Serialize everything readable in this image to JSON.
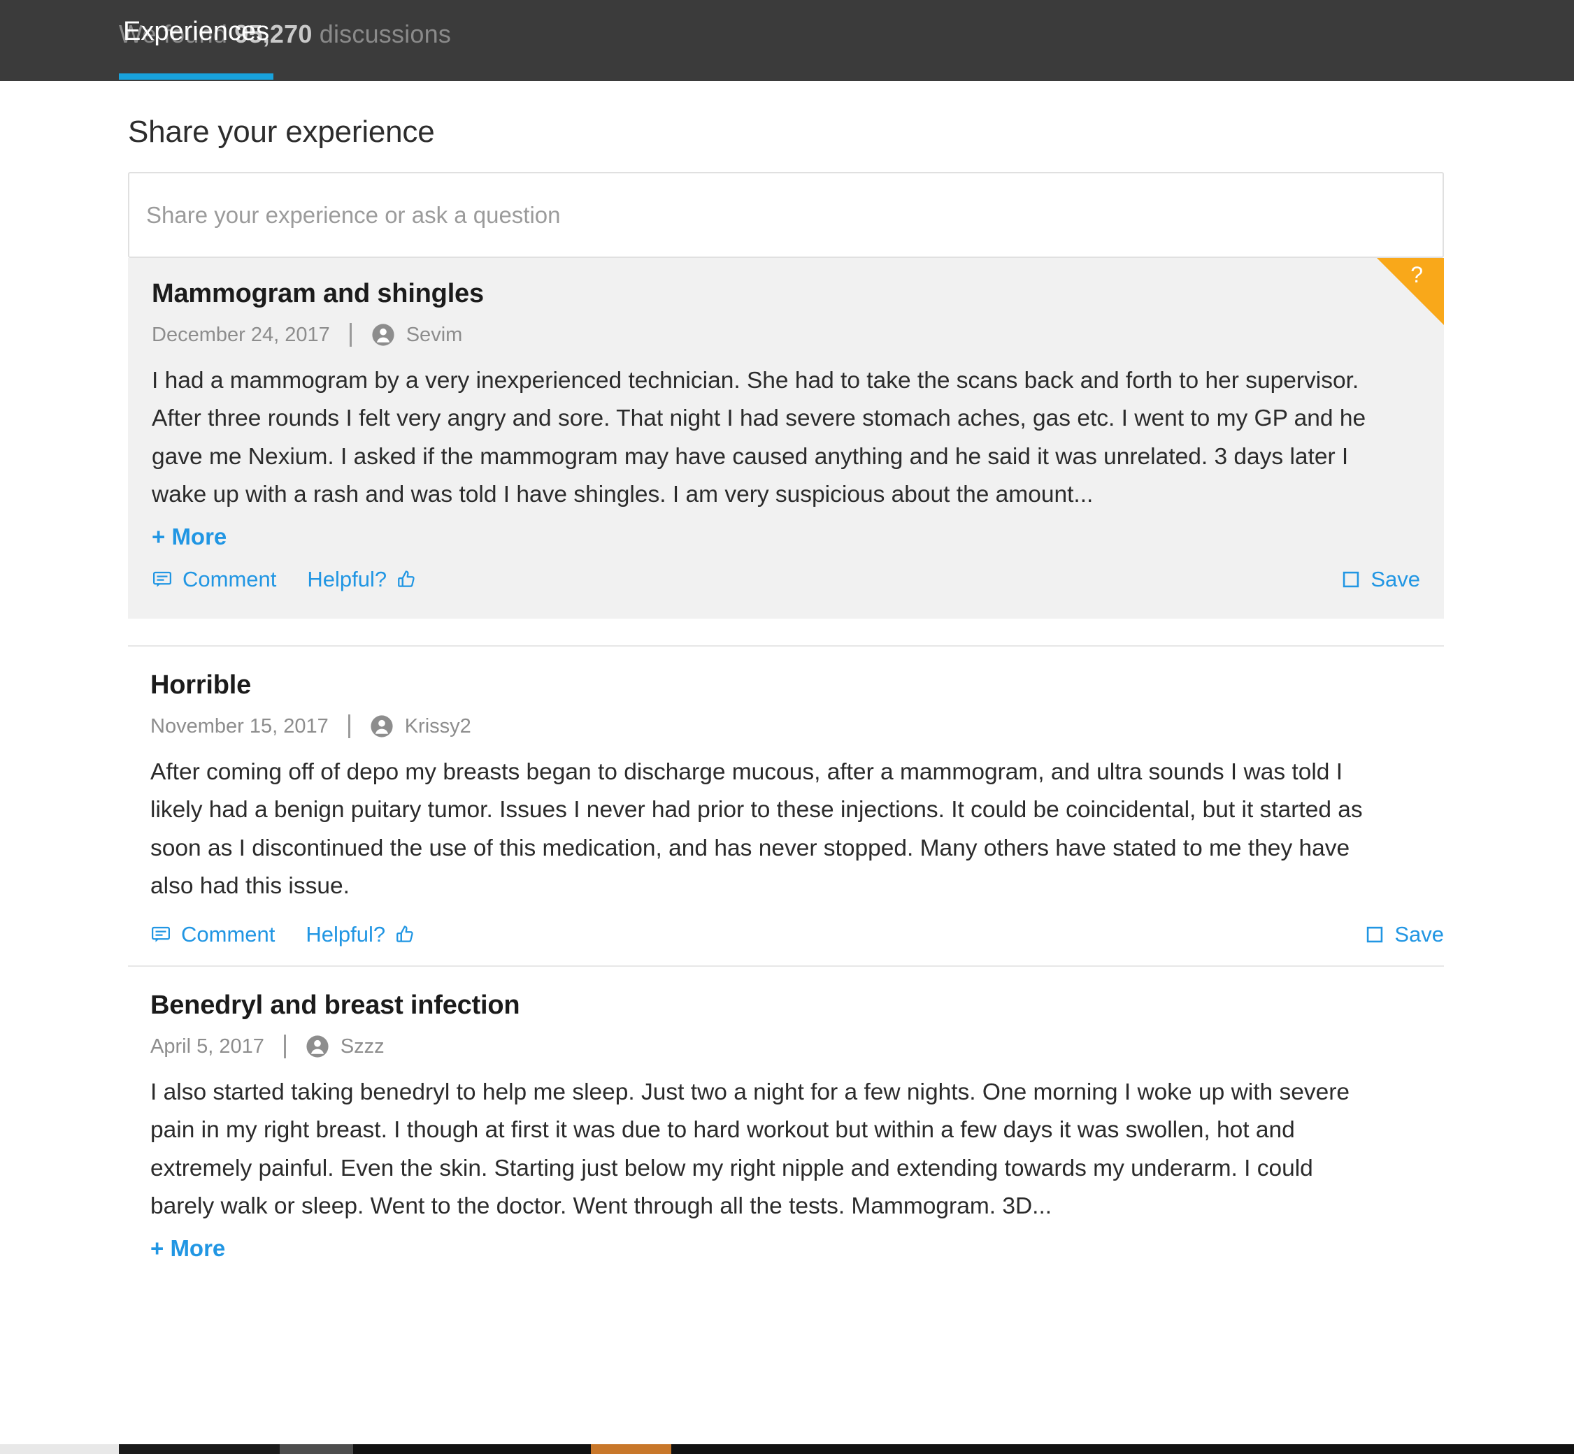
{
  "topbar": {
    "found_prefix": "We found ",
    "found_count": "95,270",
    "found_suffix": " discussions",
    "tabs": [
      {
        "label": "Experiences",
        "active": true
      }
    ]
  },
  "share": {
    "heading": "Share your experience",
    "placeholder": "Share your experience or ask a question",
    "value": ""
  },
  "actions": {
    "comment": "Comment",
    "helpful": "Helpful?",
    "save": "Save",
    "more": "+ More"
  },
  "posts": [
    {
      "title": "Mammogram and shingles",
      "date": "December 24, 2017",
      "author": "Sevim",
      "body": "I had a mammogram by a very inexperienced technician. She had to take the scans back and forth to her supervisor. After three rounds I felt very angry and sore. That night I had severe stomach aches, gas etc. I went to my GP and he gave me Nexium. I asked if the mammogram may have caused anything and he said it was unrelated. 3 days later I wake up with a rash and was told I have shingles. I am very suspicious about the amount...",
      "has_more": true,
      "highlighted": true,
      "flag": "?"
    },
    {
      "title": "Horrible",
      "date": "November 15, 2017",
      "author": "Krissy2",
      "body": "After coming off of depo my breasts began to discharge mucous, after a mammogram, and ultra sounds I was told I likely had a benign puitary tumor. Issues I never had prior to these injections. It could be coincidental, but it started as soon as I discontinued the use of this medication, and has never stopped. Many others have stated to me they have also had this issue.",
      "has_more": false,
      "highlighted": false,
      "flag": ""
    },
    {
      "title": "Benedryl and breast infection",
      "date": "April 5, 2017",
      "author": "Szzz",
      "body": "I also started taking benedryl to help me sleep. Just two a night for a few nights. One morning I woke up with severe pain in my right breast. I though at first it was due to hard workout but within a few days it was swollen, hot and extremely painful. Even the skin. Starting just below my right nipple and extending towards my underarm. I could barely walk or sleep. Went to the doctor. Went through all the tests. Mammogram. 3D...",
      "has_more": true,
      "highlighted": false,
      "flag": ""
    }
  ],
  "colors": {
    "accent_blue": "#18a2dc",
    "link_blue": "#2196e3",
    "flag_orange": "#f9a81a",
    "topbar_bg": "#3b3b3b",
    "highlight_bg": "#f1f1f1"
  }
}
